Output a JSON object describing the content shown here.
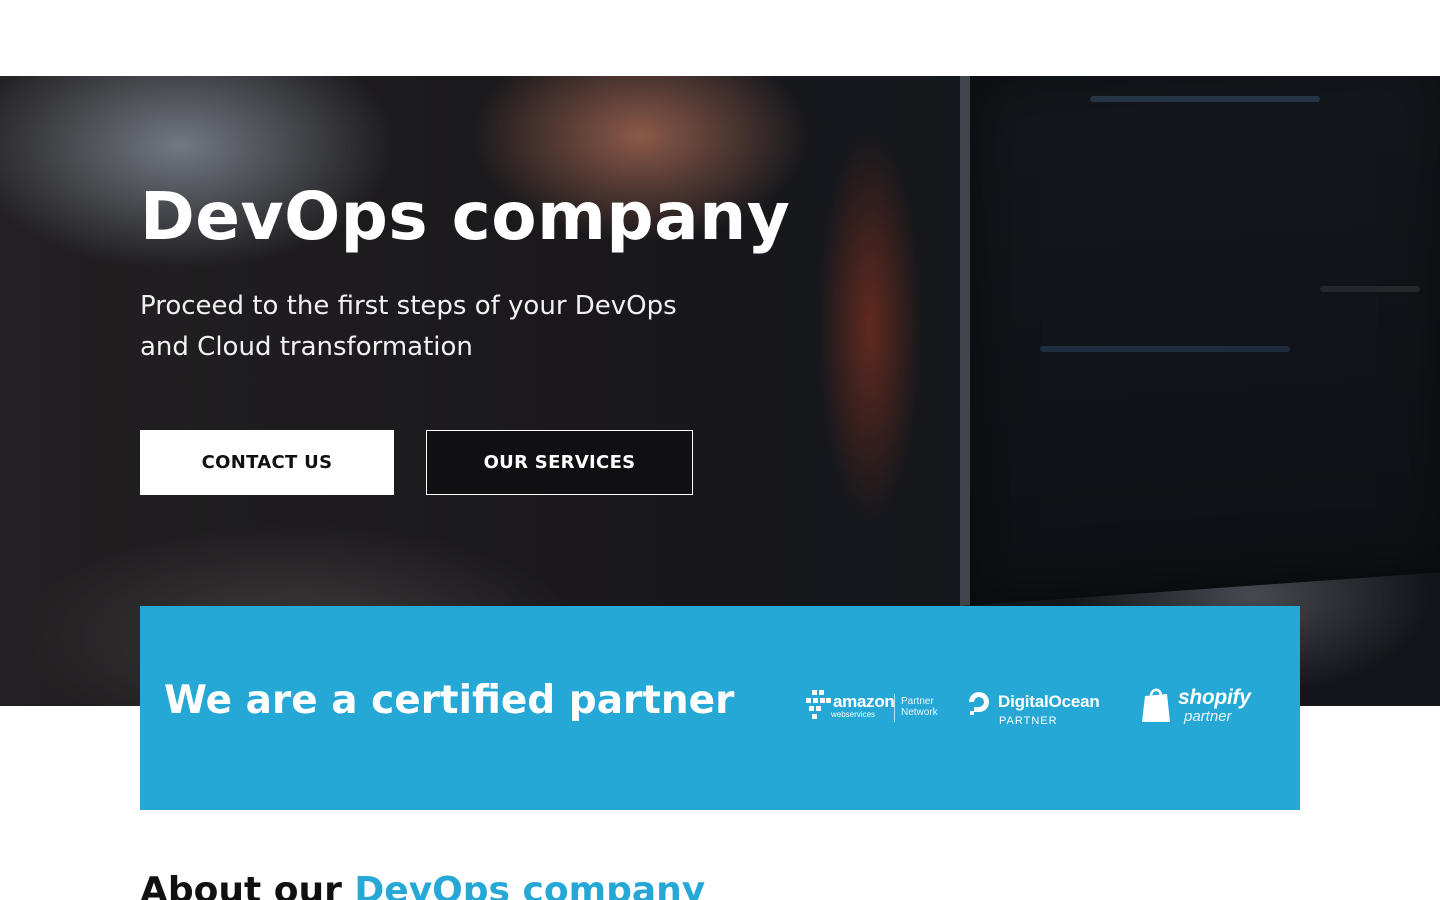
{
  "hero": {
    "title": "DevOps company",
    "subtitle": "Proceed to the first steps of your DevOps and Cloud transformation",
    "contact_label": "CONTACT US",
    "services_label": "OUR SERVICES"
  },
  "partners": {
    "title": "We are a certified partner",
    "aws": {
      "word": "amazon",
      "sub": "webservices",
      "pn_line1": "Partner",
      "pn_line2": "Network"
    },
    "digitalocean": {
      "word": "DigitalOcean",
      "sub": "PARTNER"
    },
    "shopify": {
      "word": "shopify",
      "sub": "partner"
    }
  },
  "about": {
    "title_prefix": "About our ",
    "title_accent": "DevOps company"
  },
  "colors": {
    "accent": "#25a8d6",
    "white": "#ffffff",
    "dark_text": "#111111"
  },
  "icons": {
    "aws_logo": "aws-cubes-icon",
    "digitalocean_logo": "digitalocean-drop-icon",
    "shopify_logo": "shopify-bag-icon"
  }
}
